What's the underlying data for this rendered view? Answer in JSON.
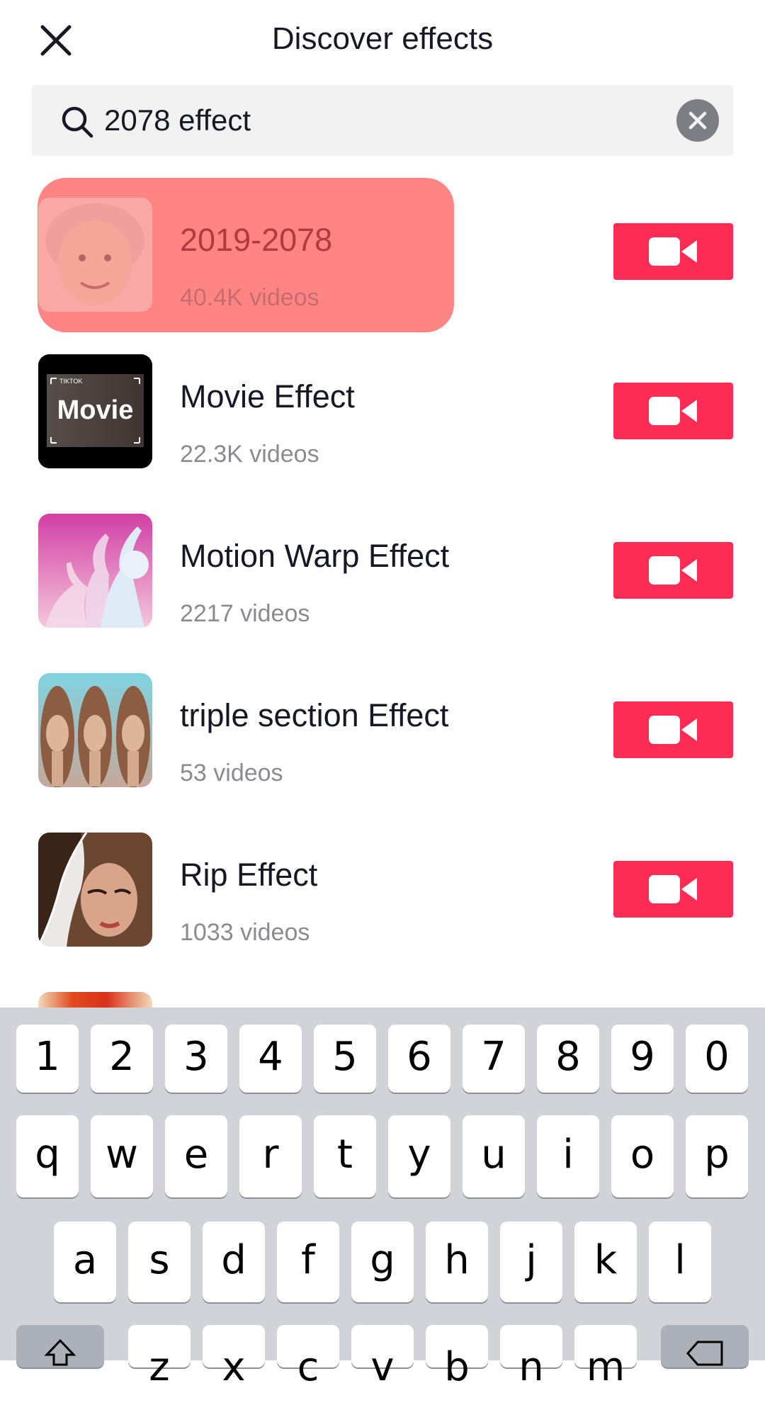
{
  "header": {
    "title": "Discover effects",
    "close_icon": "close-icon"
  },
  "search": {
    "query": "2078 effect",
    "icon": "search-icon",
    "clear_icon": "clear-icon"
  },
  "results": [
    {
      "name": "2019-2078",
      "count": "40.4K videos",
      "highlighted": true,
      "thumb": "elderly-face-thumbnail"
    },
    {
      "name": "Movie Effect",
      "count": "22.3K videos",
      "highlighted": false,
      "thumb": "movie-thumbnail",
      "thumb_text": "Movie",
      "thumb_small": "TIKTOK"
    },
    {
      "name": "Motion Warp Effect",
      "count": "2217 videos",
      "highlighted": false,
      "thumb": "motion-warp-thumbnail"
    },
    {
      "name": "triple section Effect",
      "count": "53 videos",
      "highlighted": false,
      "thumb": "triple-face-thumbnail"
    },
    {
      "name": "Rip Effect",
      "count": "1033 videos",
      "highlighted": false,
      "thumb": "rip-thumbnail"
    }
  ],
  "record_button_icon": "video-camera-icon",
  "colors": {
    "accent": "#fe2c55",
    "highlight": "#ff5c5c",
    "keyboard_bg": "#d1d3d9"
  },
  "keyboard": {
    "row1": [
      "1",
      "2",
      "3",
      "4",
      "5",
      "6",
      "7",
      "8",
      "9",
      "0"
    ],
    "row2": [
      "q",
      "w",
      "e",
      "r",
      "t",
      "y",
      "u",
      "i",
      "o",
      "p"
    ],
    "row3": [
      "a",
      "s",
      "d",
      "f",
      "g",
      "h",
      "j",
      "k",
      "l"
    ],
    "row4": [
      "z",
      "x",
      "c",
      "v",
      "b",
      "n",
      "m"
    ]
  }
}
